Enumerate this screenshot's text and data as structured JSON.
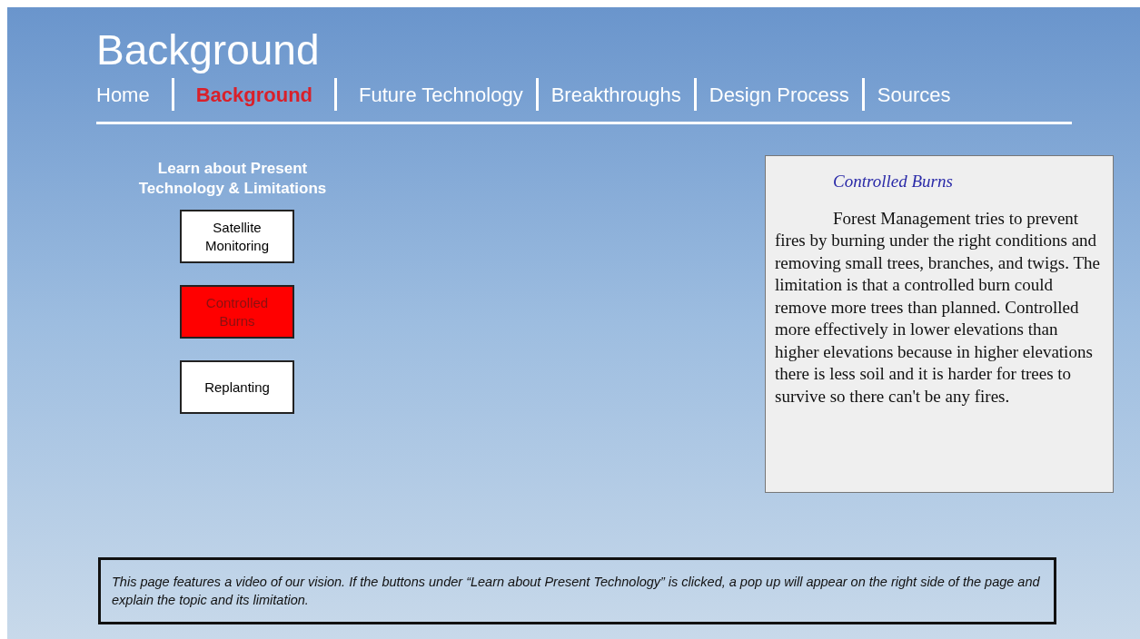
{
  "page_title": "Background",
  "nav": [
    {
      "label": "Home",
      "selected": false
    },
    {
      "label": "Background",
      "selected": true
    },
    {
      "label": "Future Technology",
      "selected": false
    },
    {
      "label": "Breakthroughs",
      "selected": false
    },
    {
      "label": "Design Process",
      "selected": false
    },
    {
      "label": "Sources",
      "selected": false
    }
  ],
  "sidebar": {
    "heading": "Learn about Present Technology & Limitations",
    "buttons": [
      {
        "label": "Satellite Monitoring",
        "selected": false
      },
      {
        "label": "Controlled Burns",
        "selected": true
      },
      {
        "label": "Replanting",
        "selected": false
      }
    ]
  },
  "popup": {
    "title": "Controlled Burns",
    "body": "Forest Management tries to prevent fires by burning under the right conditions and removing small trees, branches, and twigs.  The limitation is that a controlled burn could remove more trees than planned.  Controlled more effectively in lower elevations than higher elevations because in higher elevations there is less soil and it is harder for trees to survive so there can't be any fires."
  },
  "caption": "This page features a video of our vision.  If the buttons under “Learn about Present Technology” is clicked, a pop up will appear  on the right side of the page and explain the topic and its limitation."
}
